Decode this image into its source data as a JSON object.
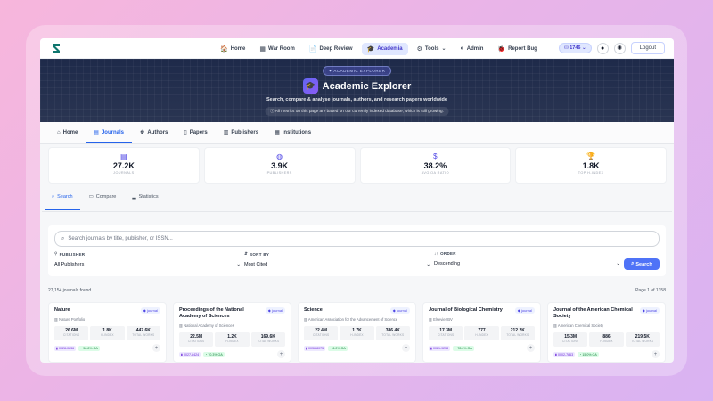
{
  "nav": {
    "links": [
      {
        "icon": "🏠",
        "label": "Home"
      },
      {
        "icon": "▦",
        "label": "War Room"
      },
      {
        "icon": "📄",
        "label": "Deep Review"
      },
      {
        "icon": "🎓",
        "label": "Academia"
      },
      {
        "icon": "⚙",
        "label": "Tools"
      },
      {
        "icon": "◐",
        "label": "Admin"
      },
      {
        "icon": "🐞",
        "label": "Report Bug"
      }
    ],
    "coins": "1746",
    "logout": "Logout"
  },
  "hero": {
    "badge": "ACADEMIC EXPLORER",
    "title": "Academic Explorer",
    "subtitle": "Search, compare & analyse journals, authors, and research papers worldwide",
    "note": "All metrics on this page are based on our currently indexed database, which is still growing."
  },
  "tabs": [
    "Home",
    "Journals",
    "Authors",
    "Papers",
    "Publishers",
    "Institutions"
  ],
  "stats": [
    {
      "icon": "▤",
      "value": "27.2K",
      "label": "JOURNALS"
    },
    {
      "icon": "◍",
      "value": "3.9K",
      "label": "PUBLISHERS"
    },
    {
      "icon": "$",
      "value": "38.2%",
      "label": "AVG OA RATIO"
    },
    {
      "icon": "🏆",
      "value": "1.8K",
      "label": "TOP H-INDEX"
    }
  ],
  "subtabs": [
    "Search",
    "Compare",
    "Statistics"
  ],
  "search": {
    "placeholder": "Search journals by title, publisher, or ISSN...",
    "publisher_label": "PUBLISHER",
    "publisher_value": "All Publishers",
    "sort_label": "SORT BY",
    "sort_value": "Most Cited",
    "order_label": "ORDER",
    "order_value": "Descending",
    "button": "Search"
  },
  "results": {
    "count": "27,154 journals found",
    "page": "Page 1 of 1358"
  },
  "stat_labels": {
    "citations": "CITATIONS",
    "hindex": "H-INDEX",
    "works": "TOTAL WORKS"
  },
  "cards": [
    {
      "title": "Nature",
      "tag": "journal",
      "publisher": "Nature Portfolio",
      "citations": "26.6M",
      "hindex": "1.8K",
      "works": "447.6K",
      "issn": "0028-0836",
      "oa": "56.8% OA"
    },
    {
      "title": "Proceedings of the National Academy of Sciences",
      "tag": "journal",
      "publisher": "National Academy of Sciences",
      "citations": "22.5M",
      "hindex": "1.2K",
      "works": "169.6K",
      "issn": "0027-8424",
      "oa": "70.3% OA"
    },
    {
      "title": "Science",
      "tag": "journal",
      "publisher": "American Association for the Advancement of Science",
      "citations": "22.4M",
      "hindex": "1.7K",
      "works": "386.4K",
      "issn": "0036-8075",
      "oa": "6.0% OA"
    },
    {
      "title": "Journal of Biological Chemistry",
      "tag": "journal",
      "publisher": "Elsevier BV",
      "citations": "17.3M",
      "hindex": "777",
      "works": "212.2K",
      "issn": "0021-9258",
      "oa": "78.6% OA"
    },
    {
      "title": "Journal of the American Chemical Society",
      "tag": "journal",
      "publisher": "American Chemical Society",
      "citations": "15.3M",
      "hindex": "886",
      "works": "219.5K",
      "issn": "0002-7863",
      "oa": "15.0% OA"
    }
  ]
}
